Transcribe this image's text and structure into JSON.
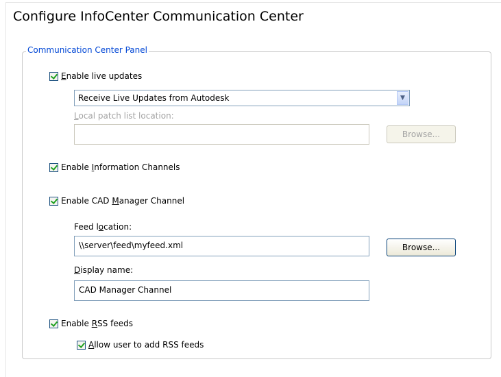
{
  "title": "Configure InfoCenter Communication Center",
  "panel_legend": "Communication Center Panel",
  "live_updates": {
    "checkbox_pre": "",
    "checkbox_u": "E",
    "checkbox_post": "nable live updates",
    "checked": true,
    "source_value": "Receive Live Updates from Autodesk",
    "local_label_u": "L",
    "local_label_post": "ocal patch list location:",
    "local_value": "",
    "browse_label": "Browse..."
  },
  "info_channels": {
    "pre": "Enable ",
    "u": "I",
    "post": "nformation Channels",
    "checked": true
  },
  "cad_channel": {
    "pre": "Enable CAD ",
    "u": "M",
    "post": "anager Channel",
    "checked": true,
    "feed_label_pre": "Feed l",
    "feed_label_u": "o",
    "feed_label_post": "cation:",
    "feed_value": "\\\\server\\feed\\myfeed.xml",
    "browse_label": "Browse...",
    "display_label_u": "D",
    "display_label_post": "isplay name:",
    "display_value": "CAD Manager Channel"
  },
  "rss": {
    "pre": "Enable ",
    "u": "R",
    "post": "SS feeds",
    "checked": true,
    "allow_u": "A",
    "allow_post": "llow user to add RSS feeds",
    "allow_checked": true
  },
  "icons": {
    "dropdown": "chevron-down-icon",
    "check": "checkmark-icon"
  },
  "colors": {
    "legend": "#0046d5",
    "check": "#21a121",
    "disabled_text": "#a3a3a3"
  }
}
